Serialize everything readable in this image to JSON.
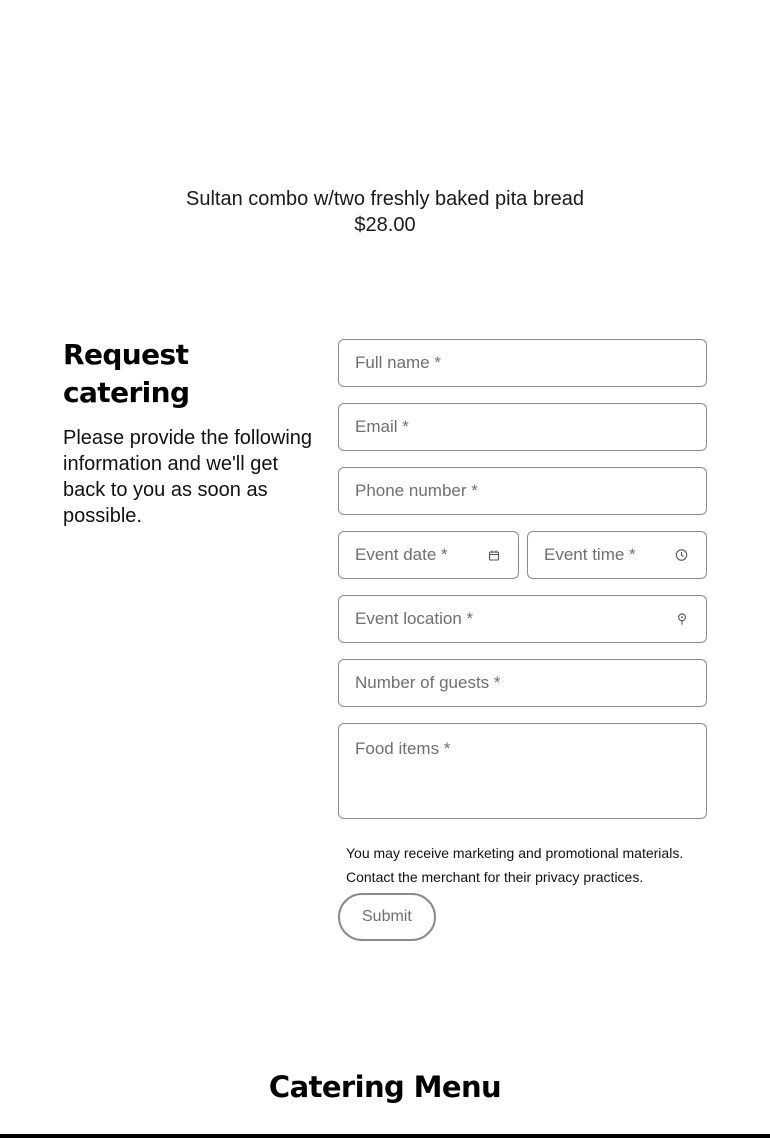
{
  "product": {
    "name": "Sultan combo w/two freshly baked pita bread",
    "price": "$28.00"
  },
  "catering": {
    "title": "Request catering",
    "description": "Please provide the following information and we'll get back to you as soon as possible."
  },
  "form": {
    "full_name_placeholder": "Full name *",
    "email_placeholder": "Email *",
    "phone_placeholder": "Phone number *",
    "event_date_placeholder": "Event date *",
    "event_time_placeholder": "Event time *",
    "event_location_placeholder": "Event location *",
    "guests_placeholder": "Number of guests *",
    "food_items_placeholder": "Food items *",
    "disclaimer": "You may receive marketing and promotional materials. Contact the merchant for their privacy practices.",
    "submit_label": "Submit",
    "icons": {
      "date": "calendar-icon",
      "time": "clock-icon",
      "location": "location-pin-icon"
    }
  },
  "menu_section": {
    "title": "Catering Menu"
  }
}
